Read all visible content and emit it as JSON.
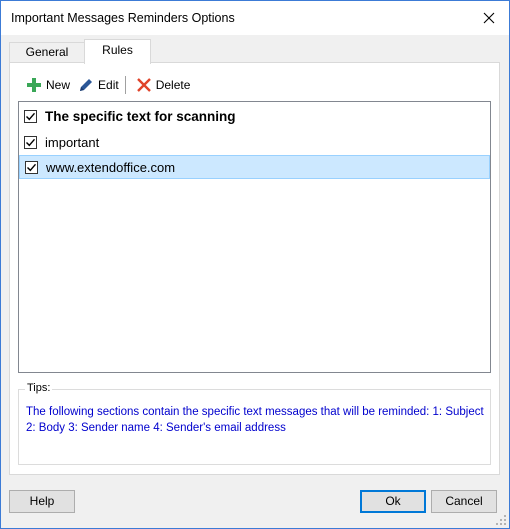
{
  "window": {
    "title": "Important Messages Reminders Options"
  },
  "tabs": [
    {
      "label": "General",
      "active": false
    },
    {
      "label": "Rules",
      "active": true
    }
  ],
  "toolbar": {
    "new_label": "New",
    "edit_label": "Edit",
    "delete_label": "Delete"
  },
  "rules": {
    "items": [
      {
        "text": "The specific text for scanning",
        "checked": true,
        "bold": true,
        "selected": false
      },
      {
        "text": "important",
        "checked": true,
        "bold": false,
        "selected": false
      },
      {
        "text": "www.extendoffice.com",
        "checked": true,
        "bold": false,
        "selected": true
      }
    ]
  },
  "tips": {
    "label": "Tips:",
    "text": "The following sections contain the specific text messages that will be reminded: 1: Subject 2: Body 3: Sender name 4: Sender's email address"
  },
  "buttons": {
    "help_label": "Help",
    "ok_label": "Ok",
    "cancel_label": "Cancel"
  },
  "colors": {
    "selection_bg": "#cce8ff",
    "tips_text": "#0000cd",
    "new_icon": "#3aa757",
    "edit_icon": "#2b5797",
    "delete_icon": "#e0442a"
  }
}
